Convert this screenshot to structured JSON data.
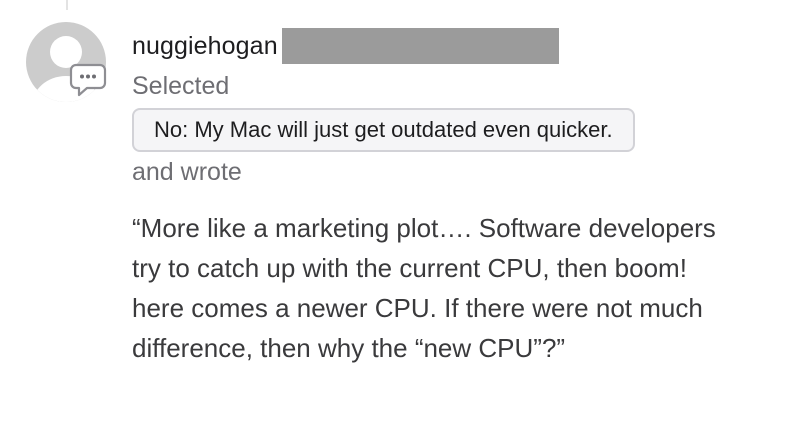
{
  "post": {
    "username": "nuggiehogan",
    "selected_label": "Selected",
    "choice": "No: My Mac will just get outdated even quicker.",
    "wrote_label": "and wrote",
    "comment": "“More like a marketing plot…. Software developers try to catch up with the current CPU, then boom! here comes a newer CPU. If there were not much difference, then why the “new CPU”?”"
  },
  "icons": {
    "avatar": "default-user-avatar-icon",
    "badge": "speech-bubble-icon"
  },
  "colors": {
    "avatar": "#cccccc",
    "text_primary": "#1d1d1f",
    "text_secondary": "#6e6e73",
    "redaction": "#9b9b9b",
    "pill_border": "#d2d2d7"
  }
}
